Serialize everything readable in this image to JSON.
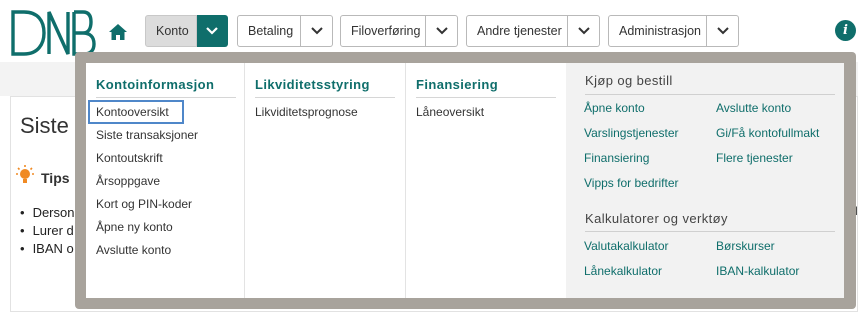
{
  "brand": {
    "logo_text": "DNB",
    "accent": "#0f6e6b",
    "frame": "#a8a39c",
    "focus": "#4f87c9"
  },
  "nav": {
    "items": [
      {
        "label": "Konto",
        "active": true
      },
      {
        "label": "Betaling",
        "active": false
      },
      {
        "label": "Filoverføring",
        "active": false
      },
      {
        "label": "Andre tjenester",
        "active": false
      },
      {
        "label": "Administrasjon",
        "active": false
      }
    ],
    "home_icon": "home-icon",
    "info_icon": "i"
  },
  "background": {
    "heading": "Siste",
    "tips_label": "Tips",
    "bullets": [
      "Derson",
      "Lurer d",
      "IBAN o"
    ],
    "edge_chars": [
      "d",
      "i"
    ]
  },
  "menu": {
    "col1": {
      "heading": "Kontoinformasjon",
      "items": [
        "Kontooversikt",
        "Siste transaksjoner",
        "Kontoutskrift",
        "Årsoppgave",
        "Kort og PIN-koder",
        "Åpne ny konto",
        "Avslutte konto"
      ]
    },
    "col2": {
      "heading": "Likviditetsstyring",
      "items": [
        "Likviditetsprognose"
      ]
    },
    "col3": {
      "heading": "Finansiering",
      "items": [
        "Låneoversikt"
      ]
    },
    "buy": {
      "heading": "Kjøp og bestill",
      "links": [
        "Åpne konto",
        "Avslutte konto",
        "Varslingstjenester",
        "Gi/Få kontofullmakt",
        "Finansiering",
        "Flere tjenester",
        "Vipps for bedrifter"
      ]
    },
    "tools": {
      "heading": "Kalkulatorer og verktøy",
      "links": [
        "Valutakalkulator",
        "Børskurser",
        "Lånekalkulator",
        "IBAN-kalkulator"
      ]
    }
  }
}
